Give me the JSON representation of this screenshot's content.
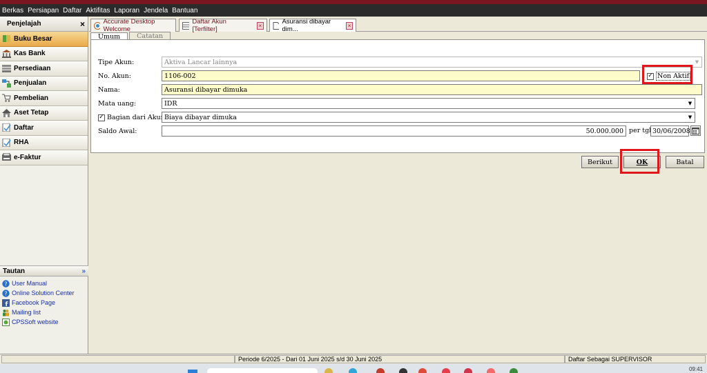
{
  "menu": [
    "Berkas",
    "Persiapan",
    "Daftar",
    "Aktifitas",
    "Laporan",
    "Jendela",
    "Bantuan"
  ],
  "sidebar": {
    "title": "Penjelajah",
    "items": [
      {
        "label": "Buku Besar",
        "icon": "ledger-icon"
      },
      {
        "label": "Kas Bank",
        "icon": "bank-icon"
      },
      {
        "label": "Persediaan",
        "icon": "inventory-icon"
      },
      {
        "label": "Penjualan",
        "icon": "sales-icon"
      },
      {
        "label": "Pembelian",
        "icon": "cart-icon"
      },
      {
        "label": "Aset Tetap",
        "icon": "house-icon"
      },
      {
        "label": "Daftar",
        "icon": "list-icon"
      },
      {
        "label": "RHA",
        "icon": "document-icon"
      },
      {
        "label": "e-Faktur",
        "icon": "invoice-icon"
      }
    ],
    "links_title": "Tautan",
    "links": [
      {
        "label": "User Manual",
        "icon": "help-icon"
      },
      {
        "label": "Online Solution Center",
        "icon": "help-icon"
      },
      {
        "label": "Facebook Page",
        "icon": "facebook-icon"
      },
      {
        "label": "Mailing list",
        "icon": "people-icon"
      },
      {
        "label": "CPSSoft website",
        "icon": "web-icon"
      }
    ]
  },
  "tabs": [
    {
      "label": "Accurate Desktop Welcome"
    },
    {
      "label": "Daftar Akun [Terfilter]"
    },
    {
      "label": "Asuransi dibayar dim..."
    }
  ],
  "subtabs": [
    "Umum",
    "Catatan"
  ],
  "form": {
    "tipe_akun_label": "Tipe Akun:",
    "tipe_akun_value": "Aktiva Lancar lainnya",
    "no_akun_label": "No. Akun:",
    "no_akun_value": "1106-002",
    "non_aktif_label": "Non Aktif",
    "non_aktif_checked": true,
    "nama_label": "Nama:",
    "nama_value": "Asuransi dibayar dimuka",
    "mata_uang_label": "Mata uang:",
    "mata_uang_value": "IDR",
    "bagian_label": "Bagian dari Akun",
    "bagian_checked": true,
    "bagian_value": "Biaya dibayar dimuka",
    "saldo_label": "Saldo Awal:",
    "saldo_value": "50.000.000",
    "per_tgl_label": "per tgl",
    "per_tgl_value": "30/06/2008"
  },
  "buttons": {
    "next": "Berikut",
    "ok": "OK",
    "cancel": "Batal"
  },
  "status": {
    "periode": "Periode 6/2025 - Dari 01 Juni 2025 s/d 30 Juni 2025",
    "user": "Daftar Sebagai SUPERVISOR"
  },
  "clock": "09:41",
  "colors": {
    "highlight": "#e0161b",
    "active_sidebar": "#e9a948",
    "required_field": "#fdfbc9"
  }
}
